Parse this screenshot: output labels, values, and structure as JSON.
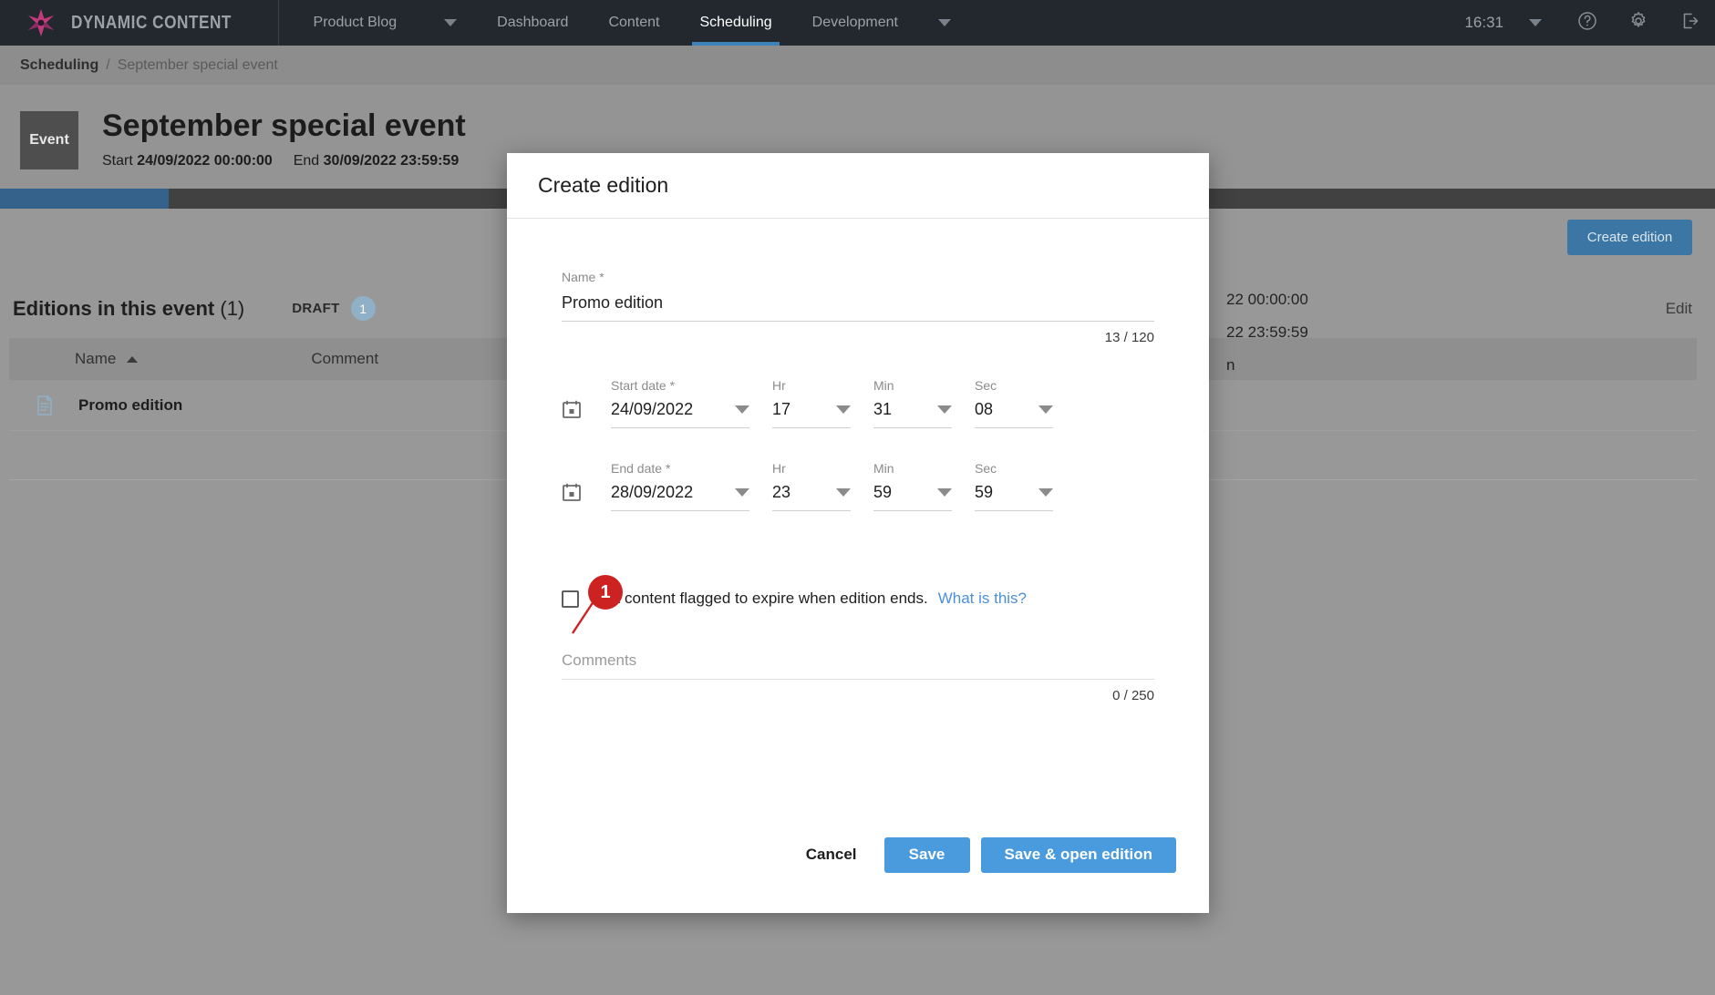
{
  "topnav": {
    "brand": "DYNAMIC CONTENT",
    "logo_icon": "dynamic-content-star-logo",
    "hub": "Product Blog",
    "hub_caret_icon": "chevron-down-icon",
    "items": [
      {
        "label": "Dashboard",
        "active": false
      },
      {
        "label": "Content",
        "active": false
      },
      {
        "label": "Scheduling",
        "active": true
      },
      {
        "label": "Development",
        "active": false
      }
    ],
    "more_caret_icon": "chevron-down-icon",
    "clock": "16:31",
    "clock_caret_icon": "chevron-down-icon",
    "help_icon": "help-circle-icon",
    "settings_icon": "gear-icon",
    "logout_icon": "logout-icon",
    "accent": "#3d82b8",
    "background": "#23282e"
  },
  "breadcrumb": {
    "root": "Scheduling",
    "separator": "/",
    "current": "September special event"
  },
  "pagehead": {
    "type_badge": "Event",
    "title": "September special event",
    "start_label": "Start",
    "start_value": "24/09/2022 00:00:00",
    "end_label": "End",
    "end_value": "30/09/2022 23:59:59",
    "edit_label": "Edit",
    "progress_fill_color": "#34628a"
  },
  "main": {
    "create_edition_button": "Create edition",
    "section_title": "Editions in this event",
    "section_count": "(1)",
    "draft_label": "DRAFT",
    "draft_count": "1",
    "edit_link": "Edit",
    "columns": [
      "Name",
      "Comment"
    ],
    "sort_icon": "sort-ascending-icon",
    "rows": [
      {
        "doc_icon": "document-icon",
        "name": "Promo edition",
        "comment": ""
      }
    ],
    "detail_lines": [
      "22 00:00:00",
      "22 23:59:59",
      "n"
    ]
  },
  "modal": {
    "title": "Create edition",
    "name": {
      "label": "Name *",
      "value": "Promo edition",
      "counter": "13 / 120"
    },
    "start": {
      "calendar_icon": "calendar-icon",
      "date_label": "Start date *",
      "date_value": "24/09/2022",
      "hr_label": "Hr",
      "hr_value": "17",
      "min_label": "Min",
      "min_value": "31",
      "sec_label": "Sec",
      "sec_value": "08"
    },
    "end": {
      "calendar_icon": "calendar-icon",
      "date_label": "End date *",
      "date_value": "28/09/2022",
      "hr_label": "Hr",
      "hr_value": "23",
      "min_label": "Min",
      "min_value": "59",
      "sec_label": "Sec",
      "sec_value": "59"
    },
    "expire": {
      "checked": false,
      "text": "Slot content flagged to expire when edition ends.",
      "link": "What is this?",
      "link_color": "#4a90d9"
    },
    "comments": {
      "placeholder": "Comments",
      "value": "",
      "counter": "0 / 250"
    },
    "footer": {
      "cancel": "Cancel",
      "save": "Save",
      "save_open": "Save & open edition",
      "primary_color": "#4a9ade"
    }
  },
  "annotation": {
    "badge_number": "1",
    "badge_color": "#cc2222",
    "target": "expire-checkbox"
  }
}
